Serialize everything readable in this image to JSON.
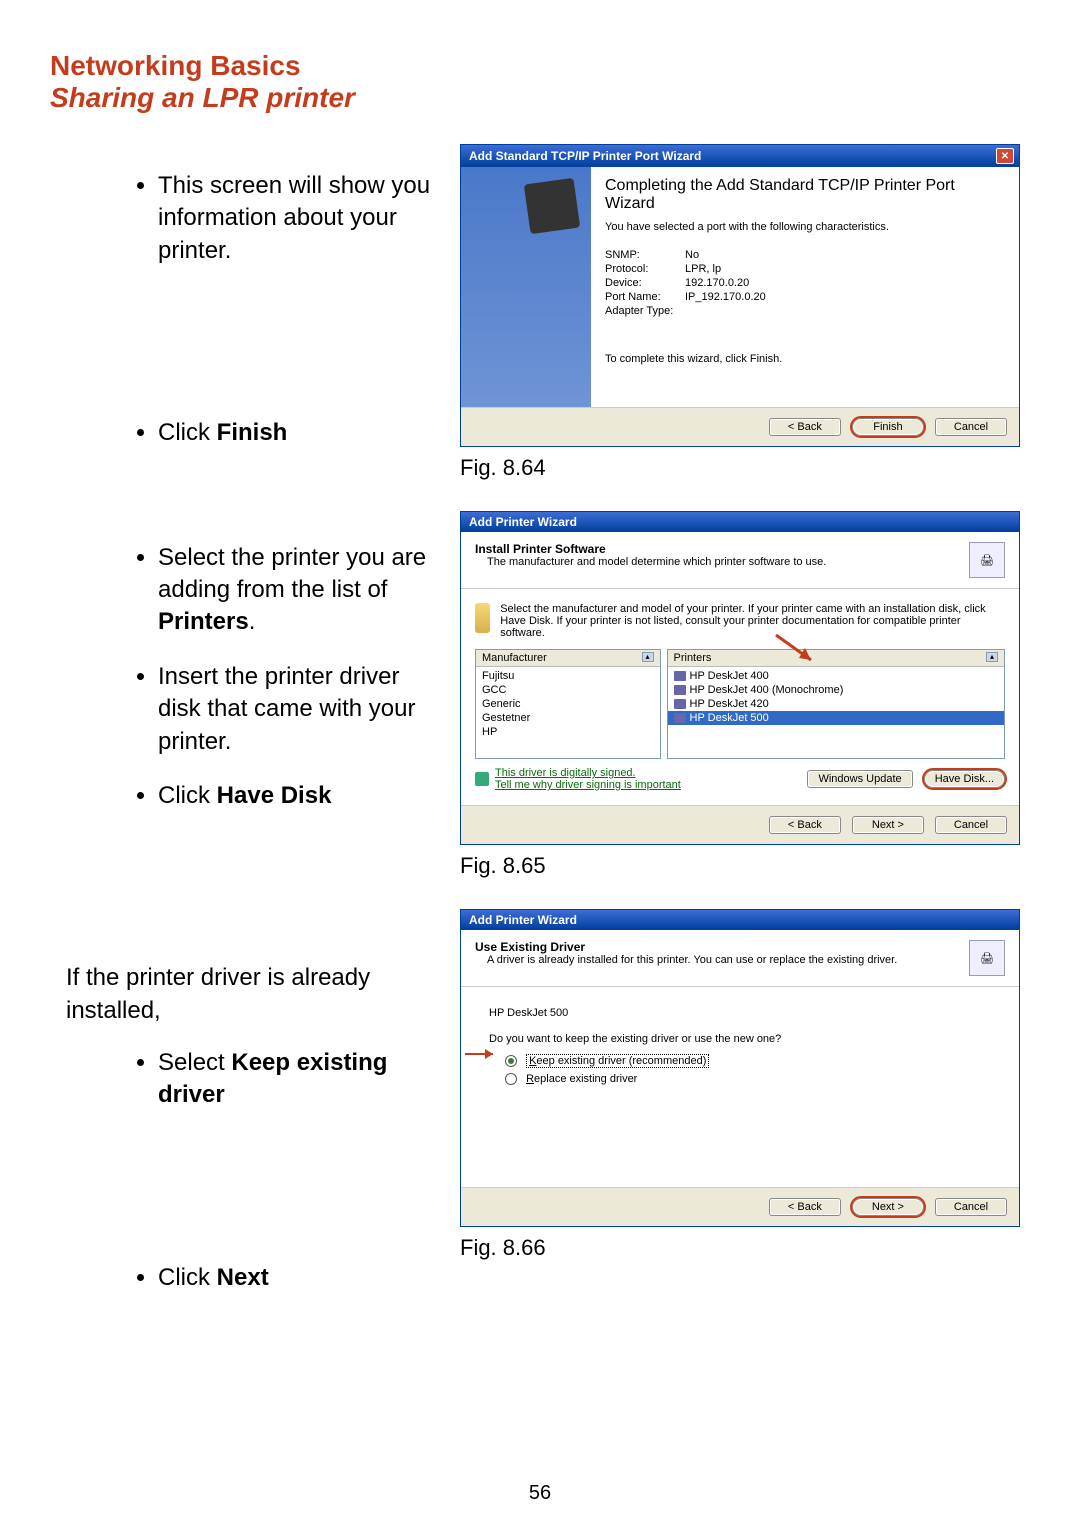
{
  "page": {
    "heading": "Networking Basics",
    "subheading": "Sharing an LPR printer",
    "number": "56"
  },
  "left": {
    "b1": "This screen will show you information about your printer.",
    "b2a": "Click ",
    "b2b": "Finish",
    "b3a": "Select the printer you are adding from the list of ",
    "b3b": "Printers",
    "b3c": ".",
    "b4": "Insert the printer driver disk that came with your printer.",
    "b5a": "Click ",
    "b5b": "Have Disk",
    "note": "If the printer driver is already installed,",
    "b6a": "Select ",
    "b6b": "Keep existing driver",
    "b7a": "Click ",
    "b7b": "Next"
  },
  "captions": {
    "c1": "Fig. 8.64",
    "c2": "Fig. 8.65",
    "c3": "Fig. 8.66"
  },
  "wiz1": {
    "title": "Add Standard TCP/IP Printer Port Wizard",
    "heading": "Completing the Add Standard TCP/IP Printer Port Wizard",
    "sub": "You have selected a port with the following characteristics.",
    "props": {
      "snmp_k": "SNMP:",
      "snmp_v": "No",
      "proto_k": "Protocol:",
      "proto_v": "LPR, lp",
      "dev_k": "Device:",
      "dev_v": "192.170.0.20",
      "port_k": "Port Name:",
      "port_v": "IP_192.170.0.20",
      "adapt_k": "Adapter Type:",
      "adapt_v": ""
    },
    "complete": "To complete this wizard, click Finish.",
    "back": "< Back",
    "finish": "Finish",
    "cancel": "Cancel"
  },
  "wiz2": {
    "title": "Add Printer Wizard",
    "hdr": "Install Printer Software",
    "hdrsub": "The manufacturer and model determine which printer software to use.",
    "info": "Select the manufacturer and model of your printer. If your printer came with an installation disk, click Have Disk. If your printer is not listed, consult your printer documentation for compatible printer software.",
    "mfr_h": "Manufacturer",
    "prn_h": "Printers",
    "mfrs": [
      "Fujitsu",
      "GCC",
      "Generic",
      "Gestetner",
      "HP"
    ],
    "prns": [
      "HP DeskJet 400",
      "HP DeskJet 400 (Monochrome)",
      "HP DeskJet 420",
      "HP DeskJet 500"
    ],
    "signed": "This driver is digitally signed.",
    "tell": "Tell me why driver signing is important",
    "winupd": "Windows Update",
    "havedisk": "Have Disk...",
    "back": "< Back",
    "next": "Next >",
    "cancel": "Cancel"
  },
  "wiz3": {
    "title": "Add Printer Wizard",
    "hdr": "Use Existing Driver",
    "hdrsub": "A driver is already installed for this printer. You can use or replace the existing driver.",
    "model": "HP DeskJet 500",
    "question": "Do you want to keep the existing driver or use the new one?",
    "opt1": "Keep existing driver (recommended)",
    "opt2": "Replace existing driver",
    "back": "< Back",
    "next": "Next >",
    "cancel": "Cancel"
  }
}
